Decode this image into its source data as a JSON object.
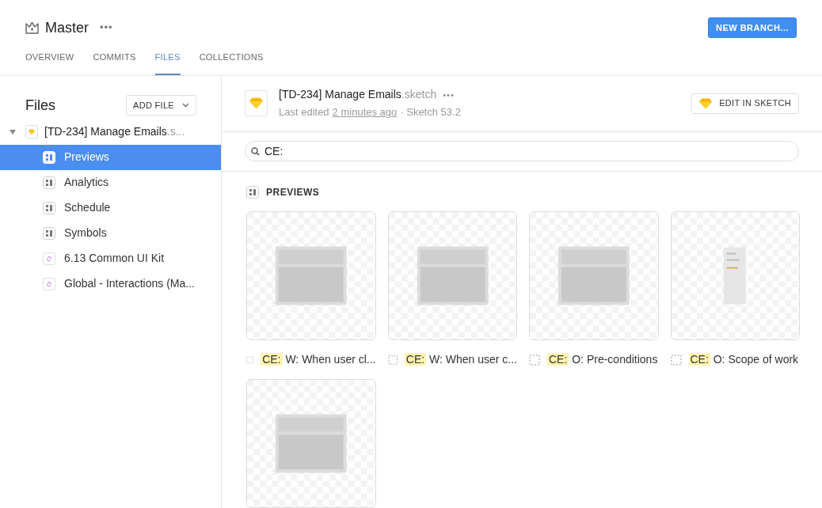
{
  "header": {
    "title": "Master",
    "more": "•••",
    "action": "NEW BRANCH..."
  },
  "tabs": [
    {
      "label": "OVERVIEW",
      "selected": false
    },
    {
      "label": "COMMITS",
      "selected": false
    },
    {
      "label": "FILES",
      "selected": true
    },
    {
      "label": "COLLECTIONS",
      "selected": false
    }
  ],
  "sidebar": {
    "title": "Files",
    "add_button": "ADD FILE",
    "file": {
      "name": "[TD-234] Manage Emails",
      "ext": ".s...",
      "expanded": true,
      "children": [
        {
          "kind": "page",
          "label": "Previews",
          "selected": true
        },
        {
          "kind": "page",
          "label": "Analytics",
          "selected": false
        },
        {
          "kind": "page",
          "label": "Schedule",
          "selected": false
        },
        {
          "kind": "page",
          "label": "Symbols",
          "selected": false
        },
        {
          "kind": "library",
          "label": "6.13 Common UI Kit",
          "selected": false
        },
        {
          "kind": "library",
          "label": "Global - Interactions (Ma...",
          "selected": false
        }
      ]
    }
  },
  "file_header": {
    "name": "[TD-234] Manage Emails",
    "ext": ".sketch",
    "more": "•••",
    "edited_prefix": "Last edited",
    "edited_link": "2 minutes ago",
    "version": "· Sketch 53.2",
    "action": "EDIT IN SKETCH"
  },
  "search": {
    "value": "CE:"
  },
  "section": {
    "title": "PREVIEWS"
  },
  "cards": [
    {
      "match": "CE:",
      "rest": "W: When user cl...",
      "kind": "picture"
    },
    {
      "match": "CE:",
      "rest": "W: When user c...",
      "kind": "picture"
    },
    {
      "match": "CE:",
      "rest": "O: Pre-conditions",
      "kind": "picture"
    },
    {
      "match": "CE:",
      "rest": "O: Scope of work",
      "kind": "picture"
    },
    {
      "kind": "picture"
    }
  ]
}
